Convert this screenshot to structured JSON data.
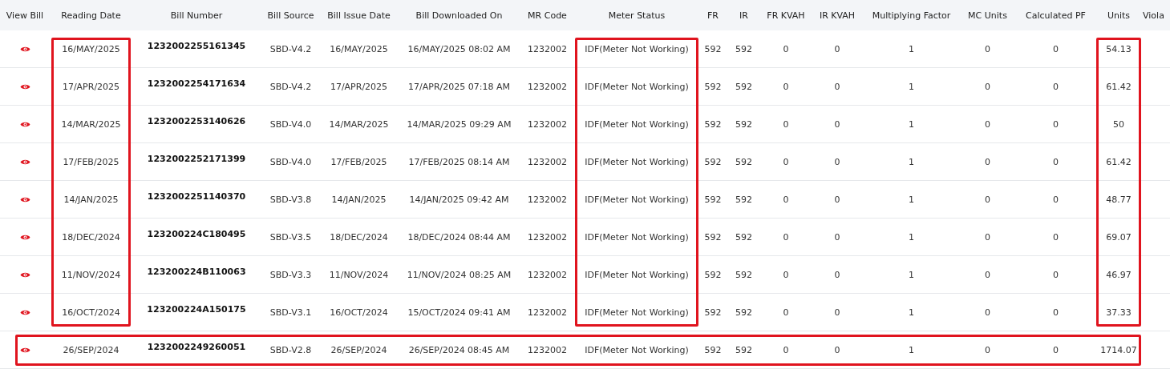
{
  "columns": [
    {
      "label": "View Bill",
      "highlighted": false
    },
    {
      "label": "Reading Date",
      "highlighted": true
    },
    {
      "label": "Bill Number",
      "highlighted": false
    },
    {
      "label": "Bill Source",
      "highlighted": false
    },
    {
      "label": "Bill Issue Date",
      "highlighted": false
    },
    {
      "label": "Bill Downloaded On",
      "highlighted": false
    },
    {
      "label": "MR Code",
      "highlighted": false
    },
    {
      "label": "Meter Status",
      "highlighted": true
    },
    {
      "label": "FR",
      "highlighted": false
    },
    {
      "label": "IR",
      "highlighted": false
    },
    {
      "label": "FR KVAH",
      "highlighted": false
    },
    {
      "label": "IR KVAH",
      "highlighted": false
    },
    {
      "label": "Multiplying Factor",
      "highlighted": false
    },
    {
      "label": "MC Units",
      "highlighted": false
    },
    {
      "label": "Calculated PF",
      "highlighted": false
    },
    {
      "label": "Units",
      "highlighted": true
    },
    {
      "label": "Viola",
      "highlighted": false
    }
  ],
  "rows": [
    {
      "highlighted": false,
      "cells": [
        "16/MAY/2025",
        "1232002255161345",
        "SBD-V4.2",
        "16/MAY/2025",
        "16/MAY/2025 08:02 AM",
        "1232002",
        "IDF(Meter Not Working)",
        "592",
        "592",
        "0",
        "0",
        "1",
        "0",
        "0",
        "54.13"
      ]
    },
    {
      "highlighted": false,
      "cells": [
        "17/APR/2025",
        "1232002254171634",
        "SBD-V4.2",
        "17/APR/2025",
        "17/APR/2025 07:18 AM",
        "1232002",
        "IDF(Meter Not Working)",
        "592",
        "592",
        "0",
        "0",
        "1",
        "0",
        "0",
        "61.42"
      ]
    },
    {
      "highlighted": false,
      "cells": [
        "14/MAR/2025",
        "1232002253140626",
        "SBD-V4.0",
        "14/MAR/2025",
        "14/MAR/2025 09:29 AM",
        "1232002",
        "IDF(Meter Not Working)",
        "592",
        "592",
        "0",
        "0",
        "1",
        "0",
        "0",
        "50"
      ]
    },
    {
      "highlighted": false,
      "cells": [
        "17/FEB/2025",
        "1232002252171399",
        "SBD-V4.0",
        "17/FEB/2025",
        "17/FEB/2025 08:14 AM",
        "1232002",
        "IDF(Meter Not Working)",
        "592",
        "592",
        "0",
        "0",
        "1",
        "0",
        "0",
        "61.42"
      ]
    },
    {
      "highlighted": false,
      "cells": [
        "14/JAN/2025",
        "1232002251140370",
        "SBD-V3.8",
        "14/JAN/2025",
        "14/JAN/2025 09:42 AM",
        "1232002",
        "IDF(Meter Not Working)",
        "592",
        "592",
        "0",
        "0",
        "1",
        "0",
        "0",
        "48.77"
      ]
    },
    {
      "highlighted": false,
      "cells": [
        "18/DEC/2024",
        "123200224C180495",
        "SBD-V3.5",
        "18/DEC/2024",
        "18/DEC/2024 08:44 AM",
        "1232002",
        "IDF(Meter Not Working)",
        "592",
        "592",
        "0",
        "0",
        "1",
        "0",
        "0",
        "69.07"
      ]
    },
    {
      "highlighted": false,
      "cells": [
        "11/NOV/2024",
        "123200224B110063",
        "SBD-V3.3",
        "11/NOV/2024",
        "11/NOV/2024 08:25 AM",
        "1232002",
        "IDF(Meter Not Working)",
        "592",
        "592",
        "0",
        "0",
        "1",
        "0",
        "0",
        "46.97"
      ]
    },
    {
      "highlighted": false,
      "cells": [
        "16/OCT/2024",
        "123200224A150175",
        "SBD-V3.1",
        "16/OCT/2024",
        "15/OCT/2024 09:41 AM",
        "1232002",
        "IDF(Meter Not Working)",
        "592",
        "592",
        "0",
        "0",
        "1",
        "0",
        "0",
        "37.33"
      ]
    },
    {
      "highlighted": true,
      "cells": [
        "26/SEP/2024",
        "1232002249260051",
        "SBD-V2.8",
        "26/SEP/2024",
        "26/SEP/2024 08:45 AM",
        "1232002",
        "IDF(Meter Not Working)",
        "592",
        "592",
        "0",
        "0",
        "1",
        "0",
        "0",
        "1714.07"
      ]
    }
  ]
}
